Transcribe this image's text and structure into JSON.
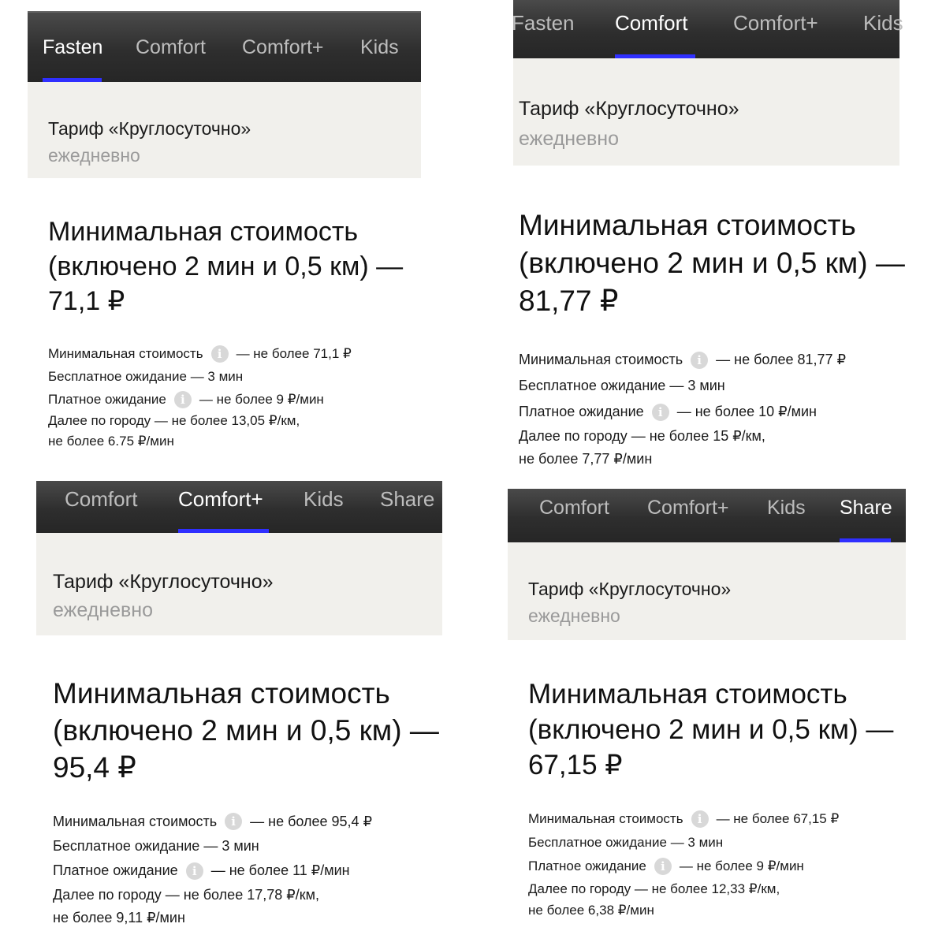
{
  "panels": [
    {
      "tabs": [
        "Fasten",
        "Comfort",
        "Comfort+",
        "Kids"
      ],
      "active_tab": "Fasten",
      "tariff_title": "Тариф «Круглосуточно»",
      "tariff_period": "ежедневно",
      "heading": "Минимальная стоимость (включено 2 мин и 0,5 км) — 71,1 ₽",
      "min_cost_label": "Минимальная стоимость",
      "min_cost_value": "— не более 71,1 ₽",
      "free_wait": "Бесплатное ожидание — 3 мин",
      "paid_wait_label": "Платное ожидание",
      "paid_wait_value": "— не более 9 ₽/мин",
      "city_line1": "Далее по городу — не более 13,05 ₽/км,",
      "city_line2": "не более 6.75 ₽/мин"
    },
    {
      "tabs": [
        "Fasten",
        "Comfort",
        "Comfort+",
        "Kids"
      ],
      "active_tab": "Comfort",
      "tariff_title": "Тариф «Круглосуточно»",
      "tariff_period": "ежедневно",
      "heading": "Минимальная стоимость (включено 2 мин и 0,5 км) — 81,77 ₽",
      "min_cost_label": "Минимальная стоимость",
      "min_cost_value": "— не более 81,77 ₽",
      "free_wait": "Бесплатное ожидание — 3 мин",
      "paid_wait_label": "Платное ожидание",
      "paid_wait_value": "— не более 10 ₽/мин",
      "city_line1": "Далее по городу — не более 15 ₽/км,",
      "city_line2": "не более 7,77 ₽/мин"
    },
    {
      "tabs": [
        "Comfort",
        "Comfort+",
        "Kids",
        "Share"
      ],
      "active_tab": "Comfort+",
      "tariff_title": "Тариф «Круглосуточно»",
      "tariff_period": "ежедневно",
      "heading": "Минимальная стоимость (включено 2 мин и 0,5 км) — 95,4 ₽",
      "min_cost_label": "Минимальная стоимость",
      "min_cost_value": "— не более 95,4 ₽",
      "free_wait": "Бесплатное ожидание — 3 мин",
      "paid_wait_label": "Платное ожидание",
      "paid_wait_value": "— не более 11 ₽/мин",
      "city_line1": "Далее по городу — не более 17,78 ₽/км,",
      "city_line2": "не более 9,11 ₽/мин"
    },
    {
      "tabs": [
        "Comfort",
        "Comfort+",
        "Kids",
        "Share"
      ],
      "active_tab": "Share",
      "tariff_title": "Тариф «Круглосуточно»",
      "tariff_period": "ежедневно",
      "heading": "Минимальная стоимость (включено 2 мин и 0,5 км) — 67,15 ₽",
      "min_cost_label": "Минимальная стоимость",
      "min_cost_value": "— не более 67,15 ₽",
      "free_wait": "Бесплатное ожидание — 3 мин",
      "paid_wait_label": "Платное ожидание",
      "paid_wait_value": "— не более 9 ₽/мин",
      "city_line1": "Далее по городу — не более 12,33 ₽/км,",
      "city_line2": "не более 6,38 ₽/мин"
    }
  ],
  "info_icon": "info-icon",
  "accent_color": "#2f2fff"
}
